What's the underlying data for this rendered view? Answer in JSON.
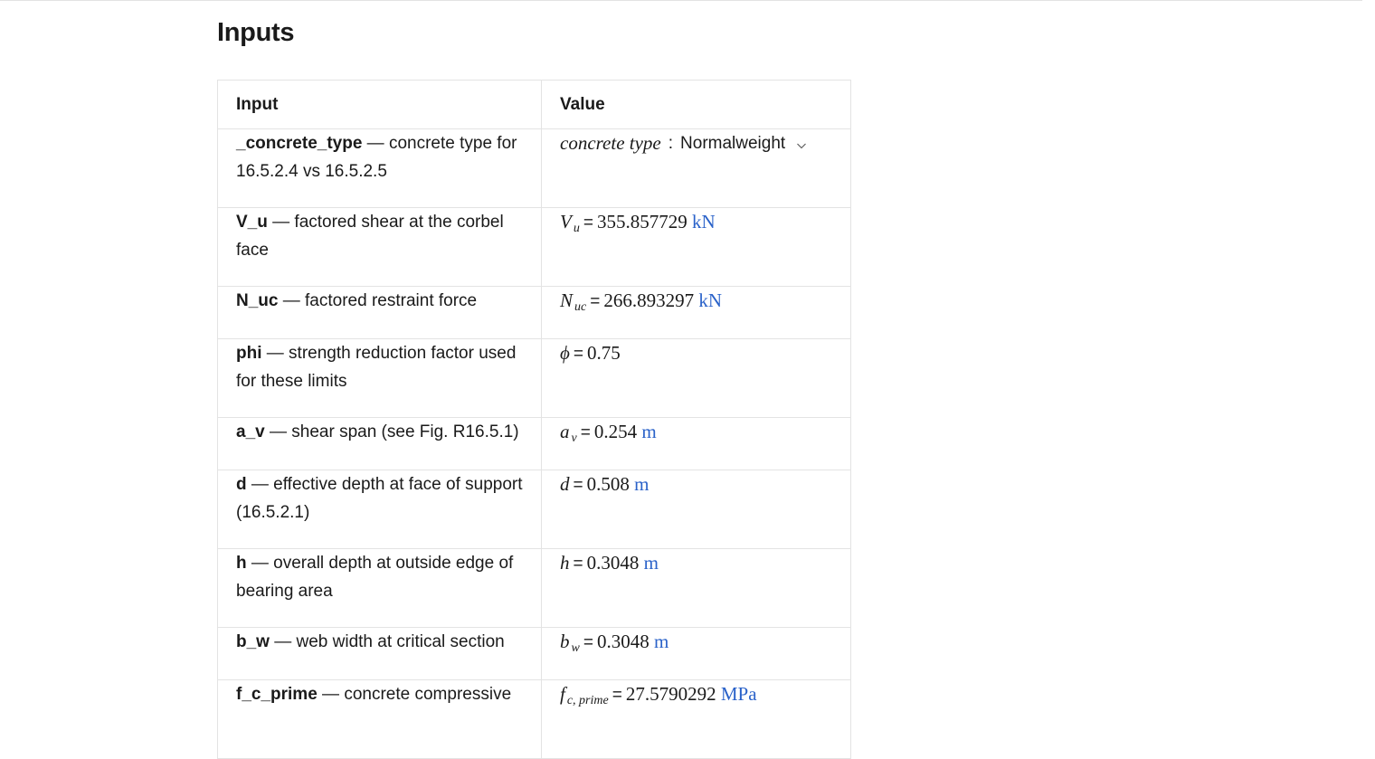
{
  "section": {
    "title": "Inputs"
  },
  "table": {
    "headers": {
      "input": "Input",
      "value": "Value"
    },
    "rows": [
      {
        "name": "_concrete_type",
        "desc": " — concrete type for 16.5.2.4 vs 16.5.2.5",
        "type": "select",
        "label": "concrete type",
        "colon": ":",
        "selected": "Normalweight"
      },
      {
        "name": "V_u",
        "desc": " — factored shear at the corbel face",
        "symbol": "V",
        "sub": "u",
        "eq": "=",
        "value": "355.857729",
        "unit": "kN"
      },
      {
        "name": "N_uc",
        "desc": " — factored restraint force",
        "symbol": "N",
        "sub": "uc",
        "eq": "=",
        "value": "266.893297",
        "unit": "kN"
      },
      {
        "name": "phi",
        "desc": " — strength reduction factor used for these limits",
        "symbol": "ϕ",
        "sub": "",
        "eq": "=",
        "value": "0.75",
        "unit": ""
      },
      {
        "name": "a_v",
        "desc": " — shear span (see Fig. R16.5.1)",
        "symbol": "a",
        "sub": "v",
        "eq": "=",
        "value": "0.254",
        "unit": "m"
      },
      {
        "name": "d",
        "desc": " — effective depth at face of support (16.5.2.1)",
        "symbol": "d",
        "sub": "",
        "eq": "=",
        "value": "0.508",
        "unit": "m"
      },
      {
        "name": "h",
        "desc": " — overall depth at outside edge of bearing area",
        "symbol": "h",
        "sub": "",
        "eq": "=",
        "value": "0.3048",
        "unit": "m"
      },
      {
        "name": "b_w",
        "desc": " — web width at critical section",
        "symbol": "b",
        "sub": "w",
        "eq": "=",
        "value": "0.3048",
        "unit": "m"
      },
      {
        "name": "f_c_prime",
        "desc": " — concrete compressive",
        "symbol": "f",
        "sub": "c, prime",
        "eq": "=",
        "value": "27.5790292",
        "unit": "MPa"
      }
    ]
  },
  "colors": {
    "unit": "#2a62c9",
    "border": "#e3e3e3",
    "text": "#1a1a1a"
  },
  "icons": {
    "dropdown": "chevron-down-icon"
  }
}
